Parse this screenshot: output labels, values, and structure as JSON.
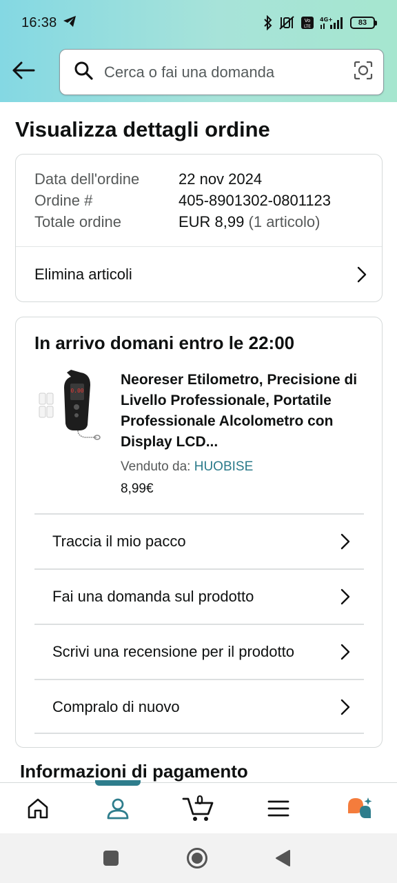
{
  "status_bar": {
    "time": "16:38",
    "battery": "83",
    "network": "4G+"
  },
  "search": {
    "placeholder": "Cerca o fai una domanda"
  },
  "page": {
    "title": "Visualizza dettagli ordine"
  },
  "order_summary": {
    "rows": [
      {
        "label": "Data dell'ordine",
        "value": "22 nov 2024"
      },
      {
        "label": "Ordine #",
        "value": "405-8901302-0801123"
      },
      {
        "label": "Totale ordine",
        "value": "EUR 8,99",
        "extra": "(1 articolo)"
      }
    ],
    "delete_items_label": "Elimina articoli"
  },
  "delivery": {
    "title": "In arrivo domani entro le 22:00",
    "product": {
      "title": "Neoreser Etilometro, Precisione di Livello Professionale, Portatile Professionale Alcolometro con Display LCD...",
      "seller_prefix": "Venduto da:",
      "seller_name": "HUOBISE",
      "price": "8,99€"
    },
    "actions": [
      {
        "label": "Traccia il mio pacco"
      },
      {
        "label": "Fai una domanda sul prodotto"
      },
      {
        "label": "Scrivi una recensione per il prodotto"
      },
      {
        "label": "Compralo di nuovo"
      }
    ]
  },
  "next_section": {
    "title": "Informazioni di pagamento"
  },
  "bottom_nav": {
    "cart_count": "0",
    "active_color": "#2e7d8c",
    "items": [
      "home-icon",
      "account-icon",
      "cart-icon",
      "menu-icon",
      "rufus-assistant-icon"
    ]
  },
  "colors": {
    "header_gradient_start": "#84d8e3",
    "header_gradient_end": "#a6e6cf",
    "link": "#2a7a8a",
    "assistant_orange": "#f47c3c",
    "assistant_teal": "#2e7d8c"
  }
}
